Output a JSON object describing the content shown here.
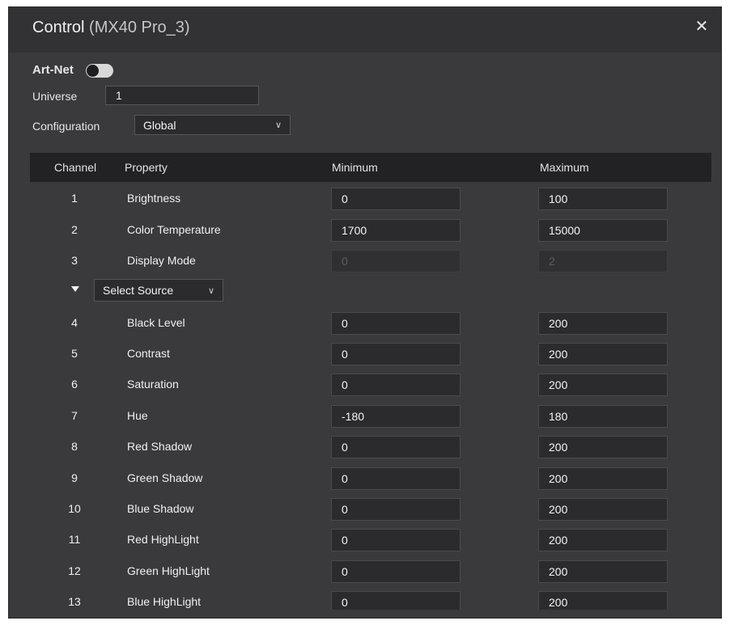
{
  "dialog": {
    "title": "Control",
    "device": "(MX40 Pro_3)",
    "close_glyph": "✕"
  },
  "artnet": {
    "label": "Art-Net",
    "enabled": false
  },
  "universe": {
    "label": "Universe",
    "value": "1"
  },
  "configuration": {
    "label": "Configuration",
    "value": "Global"
  },
  "table": {
    "headers": {
      "channel": "Channel",
      "property": "Property",
      "minimum": "Minimum",
      "maximum": "Maximum"
    },
    "source_select": "Select Source",
    "rows": [
      {
        "channel": "1",
        "property": "Brightness",
        "min": "0",
        "max": "100",
        "disabled": false
      },
      {
        "channel": "2",
        "property": "Color Temperature",
        "min": "1700",
        "max": "15000",
        "disabled": false
      },
      {
        "channel": "3",
        "property": "Display Mode",
        "min": "0",
        "max": "2",
        "disabled": true
      },
      {
        "channel": "4",
        "property": "Black Level",
        "min": "0",
        "max": "200",
        "disabled": false
      },
      {
        "channel": "5",
        "property": "Contrast",
        "min": "0",
        "max": "200",
        "disabled": false
      },
      {
        "channel": "6",
        "property": "Saturation",
        "min": "0",
        "max": "200",
        "disabled": false
      },
      {
        "channel": "7",
        "property": "Hue",
        "min": "-180",
        "max": "180",
        "disabled": false
      },
      {
        "channel": "8",
        "property": "Red Shadow",
        "min": "0",
        "max": "200",
        "disabled": false
      },
      {
        "channel": "9",
        "property": "Green Shadow",
        "min": "0",
        "max": "200",
        "disabled": false
      },
      {
        "channel": "10",
        "property": "Blue Shadow",
        "min": "0",
        "max": "200",
        "disabled": false
      },
      {
        "channel": "11",
        "property": "Red HighLight",
        "min": "0",
        "max": "200",
        "disabled": false
      },
      {
        "channel": "12",
        "property": "Green HighLight",
        "min": "0",
        "max": "200",
        "disabled": false
      },
      {
        "channel": "13",
        "property": "Blue HighLight",
        "min": "0",
        "max": "200",
        "disabled": false
      }
    ]
  }
}
